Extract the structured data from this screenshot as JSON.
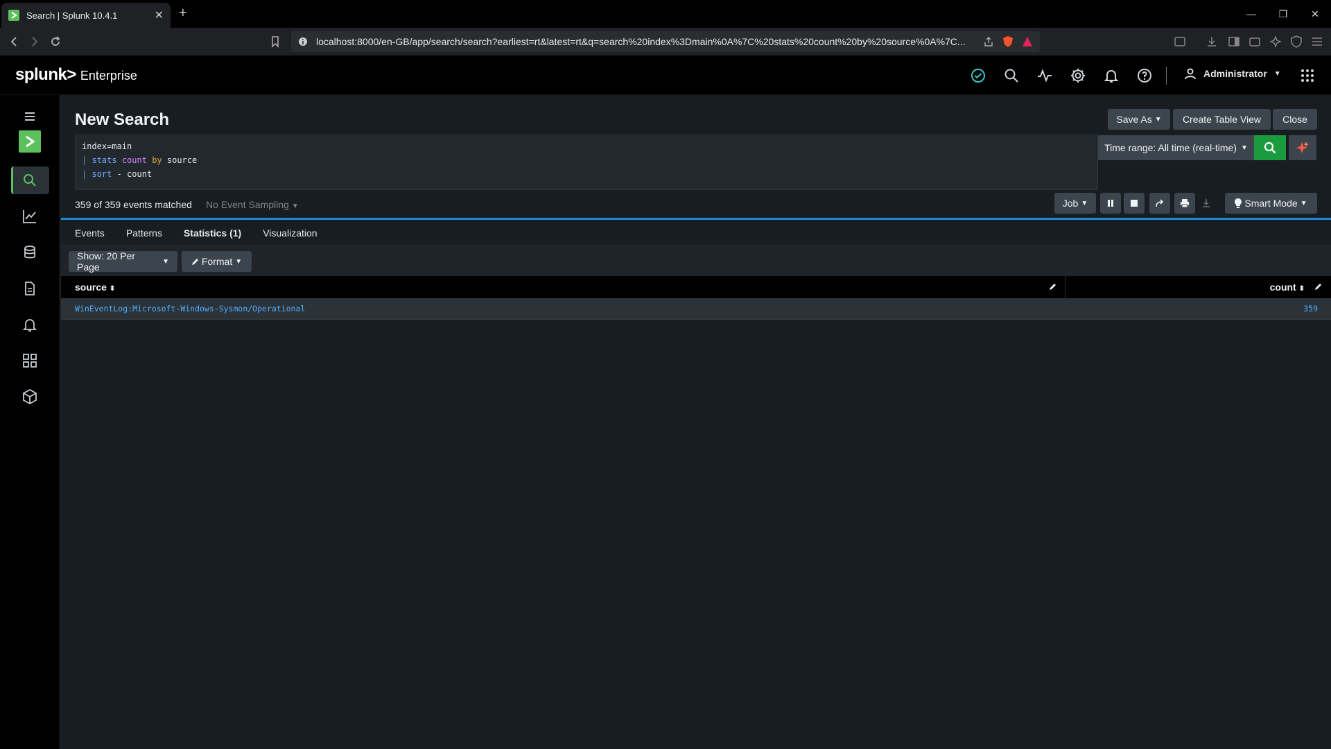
{
  "browser": {
    "tab_title": "Search | Splunk 10.4.1",
    "url": "localhost:8000/en-GB/app/search/search?earliest=rt&latest=rt&q=search%20index%3Dmain%0A%7C%20stats%20count%20by%20source%0A%7C..."
  },
  "header": {
    "brand": "splunk>",
    "product": "Enterprise",
    "user": "Administrator"
  },
  "search": {
    "title": "New Search",
    "save_as": "Save As",
    "create_table_view": "Create Table View",
    "close": "Close",
    "query_line1": "index=main",
    "query_line2_pipe": "|",
    "query_line2_cmd": "stats",
    "query_line2_fn": "count",
    "query_line2_op": "by",
    "query_line2_field": "source",
    "query_line3_pipe": "|",
    "query_line3_cmd": "sort",
    "query_line3_rest": "- count",
    "time_range": "Time range: All time (real-time)",
    "events_matched": "359 of 359 events matched",
    "sampling": "No Event Sampling",
    "job": "Job",
    "mode": "Smart Mode"
  },
  "tabs": {
    "events": "Events",
    "patterns": "Patterns",
    "statistics": "Statistics (1)",
    "visualization": "Visualization"
  },
  "results": {
    "per_page": "Show: 20 Per Page",
    "format": "Format",
    "columns": {
      "source": "source",
      "count": "count"
    },
    "rows": [
      {
        "source": "WinEventLog:Microsoft-Windows-Sysmon/Operational",
        "count": "359"
      }
    ]
  },
  "colors": {
    "accent_green": "#5cc05c",
    "search_green": "#1a9c3e",
    "link_blue": "#4fb0ff",
    "tab_blue": "#2e9fe8"
  }
}
